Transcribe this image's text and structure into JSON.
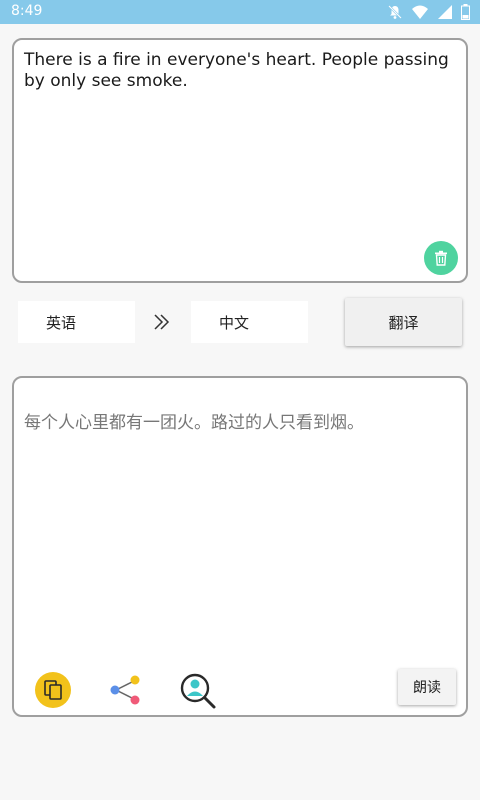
{
  "status_bar": {
    "time": "8:49",
    "icons": [
      "bell-off-icon",
      "wifi-icon",
      "signal-icon",
      "battery-icon"
    ],
    "color": "#86c9ea"
  },
  "input": {
    "text": "There is a fire in everyone's heart. People passing by only see smoke.",
    "clear_icon": "trash-icon",
    "clear_color": "#4fd39f"
  },
  "languages": {
    "from": "英语",
    "to": "中文",
    "swap_icon": "double-chevron-right-icon"
  },
  "translate_button": "翻译",
  "output": {
    "text": "每个人心里都有一团火。路过的人只看到烟。",
    "tools": [
      "copy-icon",
      "share-icon",
      "search-user-icon"
    ],
    "read_button": "朗读"
  }
}
